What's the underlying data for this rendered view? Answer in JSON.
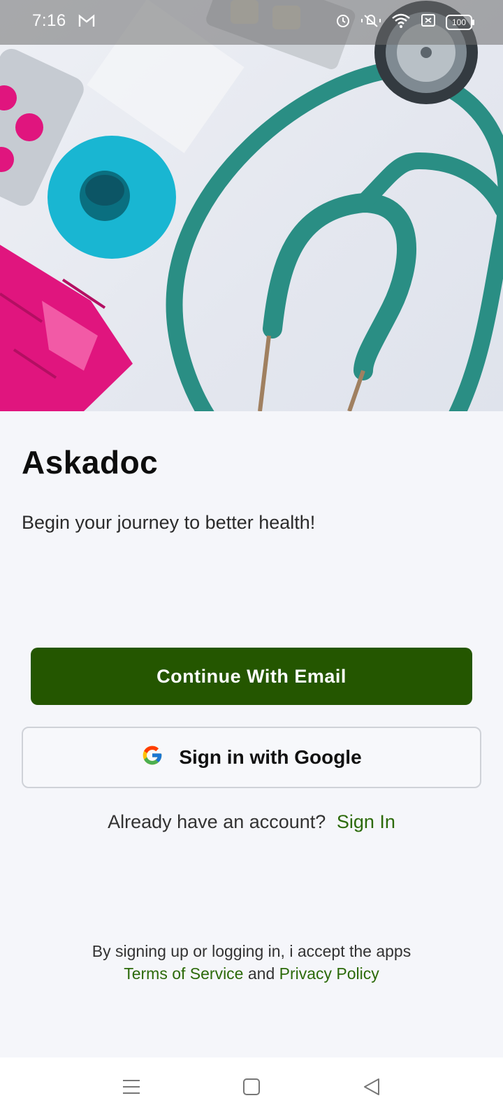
{
  "status_bar": {
    "time": "7:16",
    "battery": "100",
    "icons": [
      "gmail-icon",
      "alarm-icon",
      "mute-icon",
      "wifi-icon",
      "sim-off-icon",
      "battery-icon"
    ]
  },
  "hero": {
    "colors": {
      "stethoscope": "#2a8e84",
      "tape": "#19b6d2",
      "pills": "#e0157e"
    }
  },
  "app": {
    "title": "Askadoc",
    "subtitle": "Begin your journey to better health!"
  },
  "buttons": {
    "email_label": "Continue With Email",
    "google_label": "Sign in with Google"
  },
  "account": {
    "prompt": "Already have an account?",
    "sign_in": "Sign In"
  },
  "legal": {
    "line1": "By signing up or logging in, i accept the apps",
    "terms": "Terms of Service",
    "and": "and",
    "privacy": "Privacy Policy"
  },
  "nav": {
    "icons": [
      "menu-icon",
      "home-icon",
      "back-icon"
    ]
  },
  "colors": {
    "primary": "#245600",
    "link": "#2c6a0a",
    "background": "#f5f6fa"
  }
}
